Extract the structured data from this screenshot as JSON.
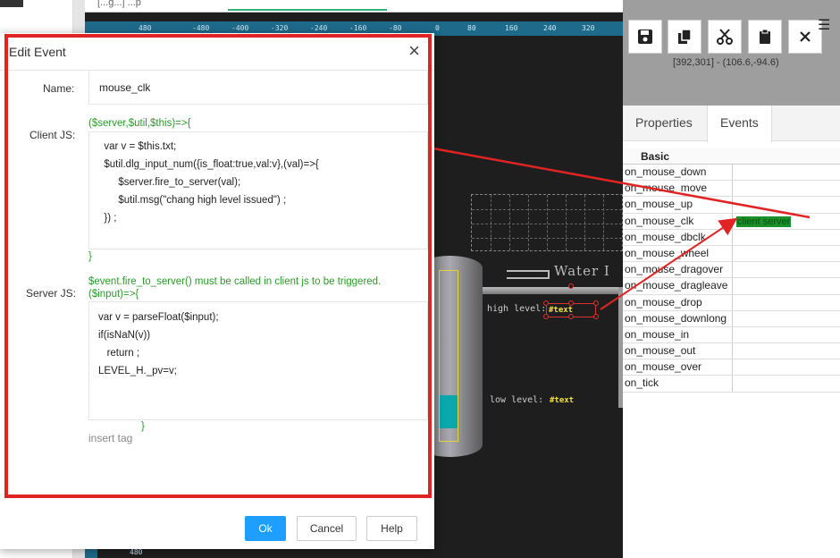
{
  "background": {
    "tab_text": "[...g...] ...p",
    "ruler_ticks": [
      "480",
      "-480",
      "-400",
      "-320",
      "-240",
      "-160",
      "-80",
      "0",
      "80",
      "160",
      "240",
      "320"
    ],
    "ruler_bottom": "480",
    "water_label": "Water I",
    "high_level_label": "high level:",
    "high_level_value": "#text",
    "low_level_label": "low  level:",
    "low_level_value": "#text"
  },
  "toolbar": {
    "coords": "[392,301] - (106.6,-94.6)"
  },
  "panel_tabs": [
    "Properties",
    "Events"
  ],
  "events_table": {
    "header": "Basic",
    "rows": [
      {
        "name": "on_mouse_down",
        "value": ""
      },
      {
        "name": "on_mouse_move",
        "value": ""
      },
      {
        "name": "on_mouse_up",
        "value": ""
      },
      {
        "name": "on_mouse_clk",
        "value": "client server"
      },
      {
        "name": "on_mouse_dbclk",
        "value": ""
      },
      {
        "name": "on_mouse_wheel",
        "value": ""
      },
      {
        "name": "on_mouse_dragover",
        "value": ""
      },
      {
        "name": "on_mouse_dragleave",
        "value": ""
      },
      {
        "name": "on_mouse_drop",
        "value": ""
      },
      {
        "name": "on_mouse_downlong",
        "value": ""
      },
      {
        "name": "on_mouse_in",
        "value": ""
      },
      {
        "name": "on_mouse_out",
        "value": ""
      },
      {
        "name": "on_mouse_over",
        "value": ""
      },
      {
        "name": "on_tick",
        "value": ""
      }
    ]
  },
  "modal": {
    "title": "Edit Event",
    "name_label": "Name:",
    "name_value": "mouse_clk",
    "client_label": "Client JS:",
    "client_signature": "($server,$util,$this)=>{",
    "client_code": "  var v = $this.txt;\n  $util.dlg_input_num({is_float:true,val:v},(val)=>{\n       $server.fire_to_server(val);\n       $util.msg(\"chang high level issued\") ;\n  }) ;",
    "client_close": "}",
    "server_label": "Server JS:",
    "server_note": "$event.fire_to_server() must be called in client js to be triggered.",
    "server_signature": "($input)=>{",
    "server_code": "var v = parseFloat($input);\nif(isNaN(v))\n   return ;\nLEVEL_H._pv=v;",
    "server_close": "}",
    "insert_tag": "insert tag",
    "ok": "Ok",
    "cancel": "Cancel",
    "help": "Help"
  },
  "colors": {
    "accent": "#1e9fff",
    "highlight_frame": "#e02424",
    "code_green": "#2a9a2a",
    "tank_fill": "#0aa7ad"
  }
}
